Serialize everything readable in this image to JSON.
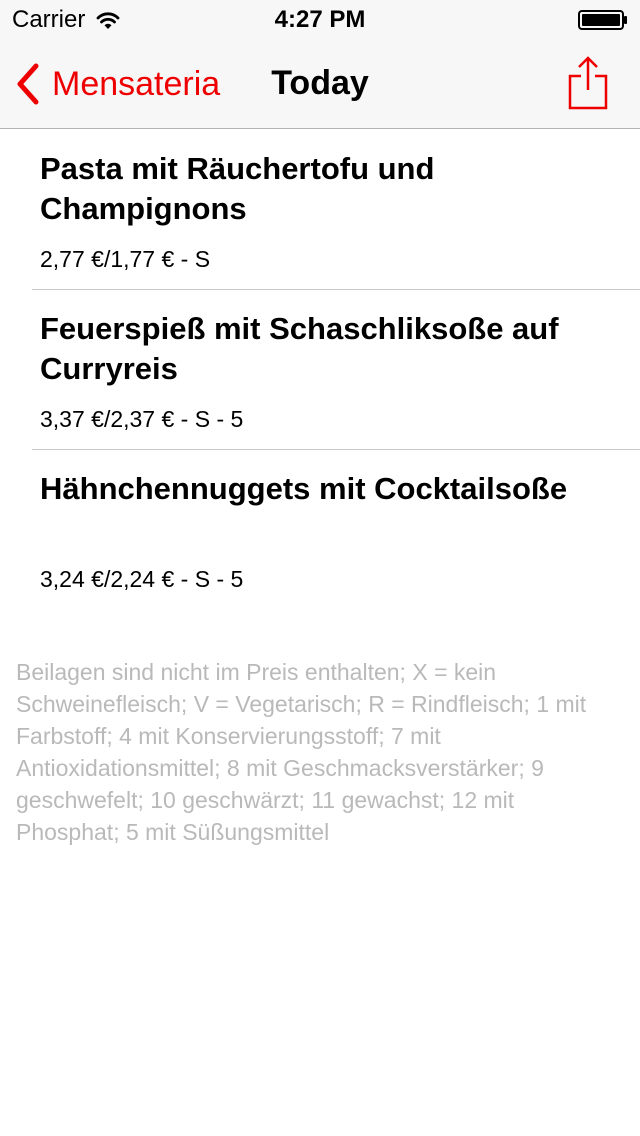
{
  "status_bar": {
    "carrier": "Carrier",
    "time": "4:27 PM"
  },
  "nav": {
    "back_label": "Mensateria",
    "title": "Today"
  },
  "colors": {
    "accent": "#ef0000",
    "legend_text": "#b9b9b9",
    "bar_background": "#f7f7f7"
  },
  "icons": {
    "back": "chevron-left-icon",
    "share": "share-icon",
    "wifi": "wifi-icon",
    "battery": "battery-icon"
  },
  "menu": {
    "items": [
      {
        "name": "Pasta mit Räuchertofu und Champignons",
        "price": "2,77 €/1,77 € - S"
      },
      {
        "name": "Feuerspieß mit Schaschliksoße  auf Curryreis",
        "price": "3,37 €/2,37 € - S - 5"
      },
      {
        "name": "Hähnchennuggets mit Cocktailsoße",
        "price": "3,24 €/2,24 € - S - 5"
      }
    ]
  },
  "legend": {
    "text": "Beilagen sind nicht im Preis enthalten; X = kein Schweinefleisch; V = Vegetarisch; R = Rindfleisch; 1 mit Farbstoff; 4 mit Konservierungsstoff; 7 mit Antioxidationsmittel; 8 mit Geschmacksverstärker; 9 geschwefelt; 10 geschwärzt; 11 gewachst; 12 mit Phosphat; 5 mit Süßungsmittel"
  }
}
